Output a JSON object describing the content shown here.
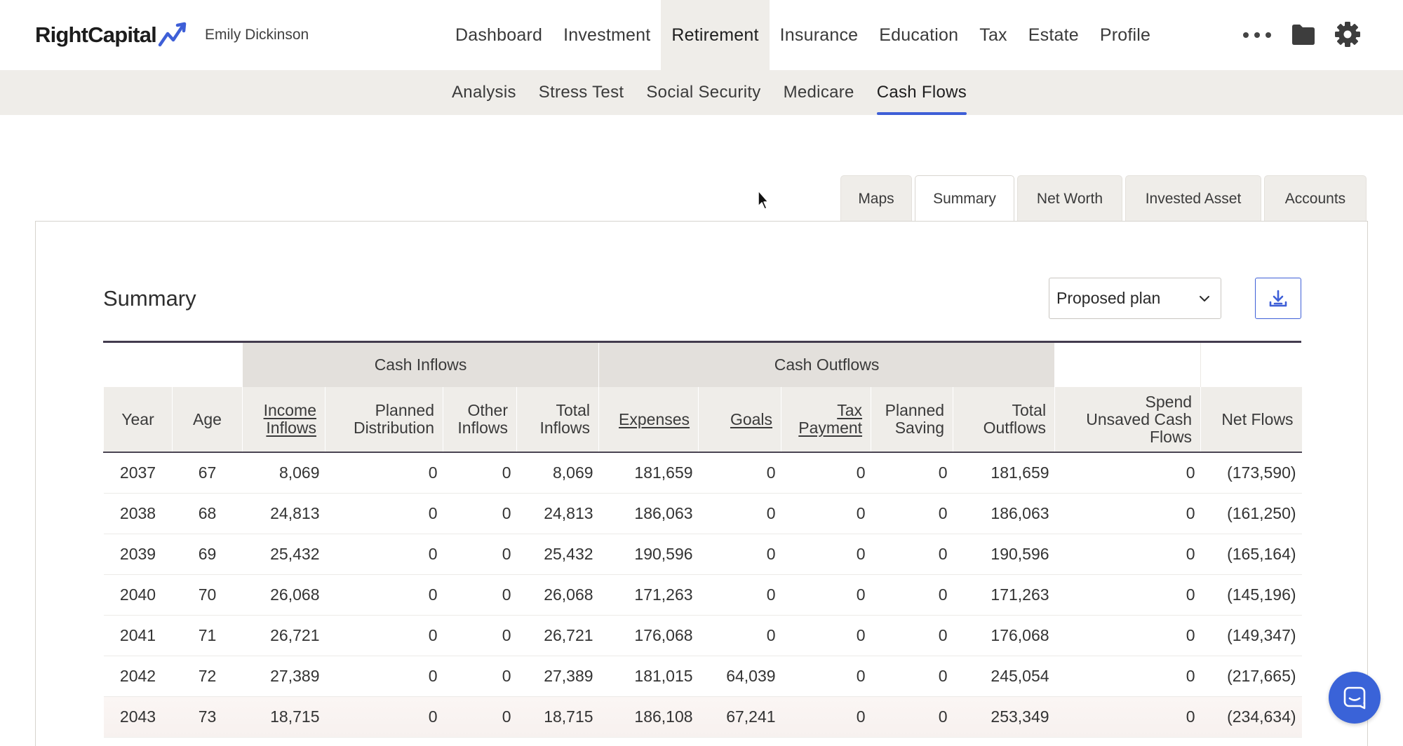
{
  "header": {
    "logo_text": "RightCapital",
    "client_name": "Emily Dickinson",
    "nav": [
      "Dashboard",
      "Investment",
      "Retirement",
      "Insurance",
      "Education",
      "Tax",
      "Estate",
      "Profile"
    ],
    "active_nav": "Retirement",
    "icons": [
      "more-icon",
      "folder-icon",
      "gear-icon"
    ]
  },
  "subnav": {
    "items": [
      "Analysis",
      "Stress Test",
      "Social Security",
      "Medicare",
      "Cash Flows"
    ],
    "active": "Cash Flows"
  },
  "page_tabs": {
    "items": [
      "Maps",
      "Summary",
      "Net Worth",
      "Invested Asset",
      "Accounts"
    ],
    "active": "Summary"
  },
  "summary": {
    "title": "Summary",
    "plan_select_value": "Proposed plan",
    "download_icon": "download-icon"
  },
  "table": {
    "groups": {
      "inflows": "Cash Inflows",
      "outflows": "Cash Outflows"
    },
    "columns": {
      "year": "Year",
      "age": "Age",
      "income_1": "Income",
      "income_2": "Inflows",
      "planned_dist_1": "Planned",
      "planned_dist_2": "Distribution",
      "other_1": "Other",
      "other_2": "Inflows",
      "total_in_1": "Total",
      "total_in_2": "Inflows",
      "expenses": "Expenses",
      "goals": "Goals",
      "tax_1": "Tax",
      "tax_2": "Payment",
      "saving_1": "Planned",
      "saving_2": "Saving",
      "total_out_1": "Total",
      "total_out_2": "Outflows",
      "unsaved_1": "Spend",
      "unsaved_2": "Unsaved Cash",
      "unsaved_3": "Flows",
      "net": "Net Flows"
    },
    "rows": [
      [
        "2037",
        "67",
        "8,069",
        "0",
        "0",
        "8,069",
        "181,659",
        "0",
        "0",
        "0",
        "181,659",
        "0",
        "(173,590)"
      ],
      [
        "2038",
        "68",
        "24,813",
        "0",
        "0",
        "24,813",
        "186,063",
        "0",
        "0",
        "0",
        "186,063",
        "0",
        "(161,250)"
      ],
      [
        "2039",
        "69",
        "25,432",
        "0",
        "0",
        "25,432",
        "190,596",
        "0",
        "0",
        "0",
        "190,596",
        "0",
        "(165,164)"
      ],
      [
        "2040",
        "70",
        "26,068",
        "0",
        "0",
        "26,068",
        "171,263",
        "0",
        "0",
        "0",
        "171,263",
        "0",
        "(145,196)"
      ],
      [
        "2041",
        "71",
        "26,721",
        "0",
        "0",
        "26,721",
        "176,068",
        "0",
        "0",
        "0",
        "176,068",
        "0",
        "(149,347)"
      ],
      [
        "2042",
        "72",
        "27,389",
        "0",
        "0",
        "27,389",
        "181,015",
        "64,039",
        "0",
        "0",
        "245,054",
        "0",
        "(217,665)"
      ],
      [
        "2043",
        "73",
        "18,715",
        "0",
        "0",
        "18,715",
        "186,108",
        "67,241",
        "0",
        "0",
        "253,349",
        "0",
        "(234,634)"
      ]
    ]
  },
  "colors": {
    "accent": "#3e5fd7",
    "nav_active_bg": "#efede9",
    "group_header_bg": "#e3e0dc",
    "header_bg": "#efede9"
  }
}
